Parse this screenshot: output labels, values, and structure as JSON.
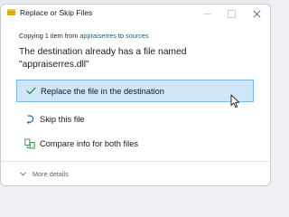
{
  "window": {
    "title": "Replace or Skip Files"
  },
  "copying": {
    "prefix": "Copying 1 item from",
    "source": "appraiserres",
    "connector": "to",
    "destination": "sources"
  },
  "headline": "The destination already has a file named \"appraiserres.dll\"",
  "options": [
    {
      "label": "Replace the file in the destination",
      "icon": "check-icon",
      "selected": true
    },
    {
      "label": "Skip this file",
      "icon": "skip-arrow-icon",
      "selected": false
    },
    {
      "label": "Compare info for both files",
      "icon": "compare-icon",
      "selected": false
    }
  ],
  "footer": {
    "more_details": "More details"
  },
  "colors": {
    "accent": "#0b5fa8",
    "selection_bg": "#cfe6f8",
    "selection_border": "#78b9e8",
    "check_green": "#2d8a3e"
  }
}
